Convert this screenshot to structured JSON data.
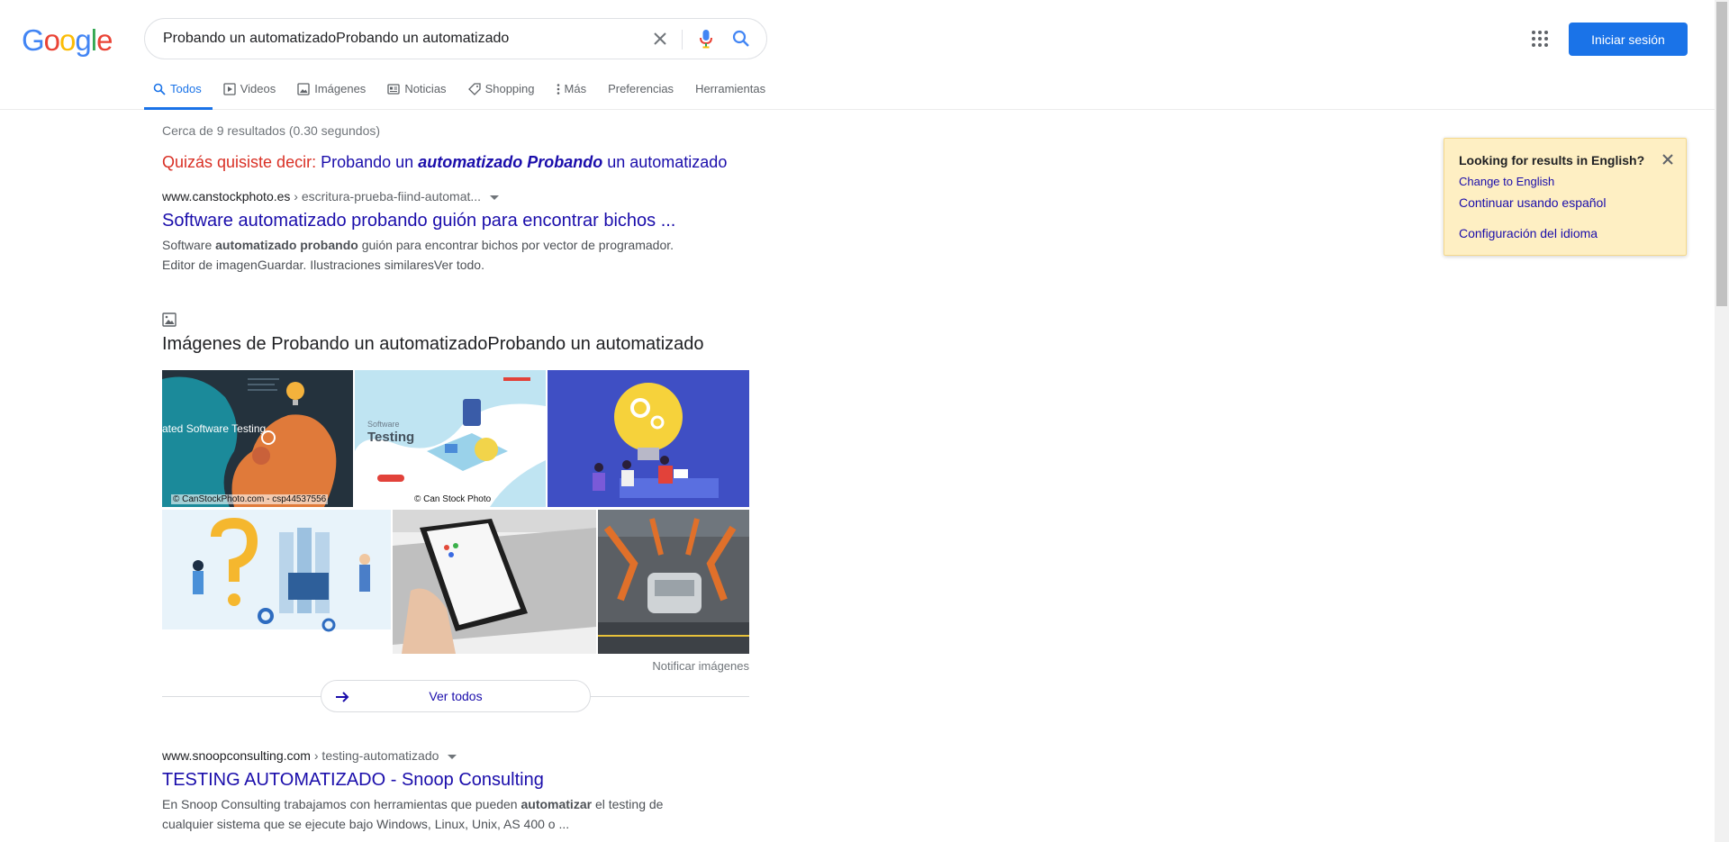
{
  "logo": {
    "letters": [
      "G",
      "o",
      "o",
      "g",
      "l",
      "e"
    ],
    "colors": [
      "#4285f4",
      "#ea4335",
      "#fbbc05",
      "#4285f4",
      "#34a853",
      "#ea4335"
    ]
  },
  "search": {
    "query": "Probando un automatizadoProbando un automatizado"
  },
  "header": {
    "signin_label": "Iniciar sesión"
  },
  "tabs": [
    {
      "label": "Todos",
      "icon": "search-icon",
      "active": true
    },
    {
      "label": "Videos",
      "icon": "play-icon"
    },
    {
      "label": "Imágenes",
      "icon": "image-icon"
    },
    {
      "label": "Noticias",
      "icon": "news-icon"
    },
    {
      "label": "Shopping",
      "icon": "tag-icon"
    },
    {
      "label": "Más",
      "icon": "more-vert-icon"
    },
    {
      "label": "Preferencias"
    },
    {
      "label": "Herramientas"
    }
  ],
  "stats": "Cerca de 9 resultados (0.30 segundos)",
  "spell": {
    "lead": "Quizás quisiste decir:",
    "p1": "Probando un",
    "b1": "automatizado Probando",
    "p2": "un automatizado"
  },
  "results": [
    {
      "domain": "www.canstockphoto.es",
      "path": " › escritura-prueba-fiind-automat...",
      "title": "Software automatizado probando guión para encontrar bichos ...",
      "snippet_a": "Software ",
      "snippet_b": "automatizado probando",
      "snippet_c": " guión para encontrar bichos por vector de programador.",
      "snippet_line2": "Editor de imagenGuardar. Ilustraciones similaresVer todo."
    },
    {
      "domain": "www.snoopconsulting.com",
      "path": " › testing-automatizado",
      "title": "TESTING AUTOMATIZADO - Snoop Consulting",
      "snippet_a": "En Snoop Consulting trabajamos con herramientas que pueden ",
      "snippet_b": "automatizar",
      "snippet_c": " el testing de",
      "snippet_line2": "cualquier sistema que se ejecute bajo Windows, Linux, Unix, AS 400 o ..."
    }
  ],
  "images": {
    "title": "Imágenes de Probando un automatizadoProbando un automatizado",
    "captions": [
      "© CanStockPhoto.com - csp44537556",
      "© Can Stock Photo"
    ],
    "thumb1_text": "ated Software Testing",
    "thumb2_text": "Software",
    "thumb2_text2": "Testing",
    "report": "Notificar imágenes",
    "see_all": "Ver todos"
  },
  "lang_panel": {
    "title": "Looking for results in English?",
    "link1": "Change to English",
    "link2": "Continuar usando español",
    "link3": "Configuración del idioma"
  },
  "colors": {
    "accent": "#1a73e8",
    "link": "#1a0dab",
    "spell_red": "#d93025",
    "panel_bg": "#feefc3"
  }
}
